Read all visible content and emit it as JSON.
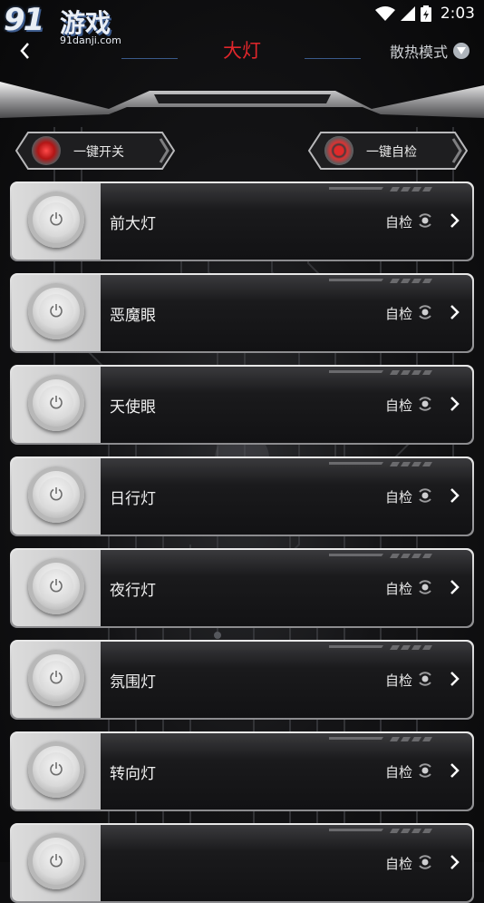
{
  "status_bar": {
    "watermark_number": "91",
    "watermark_text": "游戏",
    "watermark_site": "91danji.com",
    "time": "2:03"
  },
  "header": {
    "title": "大灯",
    "mode_label": "散热模式"
  },
  "quick_actions": {
    "switch_label": "一键开关",
    "selfcheck_label": "一键自检"
  },
  "lights": [
    {
      "label": "前大灯",
      "check_label": "自检"
    },
    {
      "label": "恶魔眼",
      "check_label": "自检"
    },
    {
      "label": "天使眼",
      "check_label": "自检"
    },
    {
      "label": "日行灯",
      "check_label": "自检"
    },
    {
      "label": "夜行灯",
      "check_label": "自检"
    },
    {
      "label": "氛围灯",
      "check_label": "自检"
    },
    {
      "label": "转向灯",
      "check_label": "自检"
    },
    {
      "label": "",
      "check_label": "自检"
    }
  ],
  "colors": {
    "accent_red": "#e0262b",
    "background": "#0d0d0f"
  }
}
